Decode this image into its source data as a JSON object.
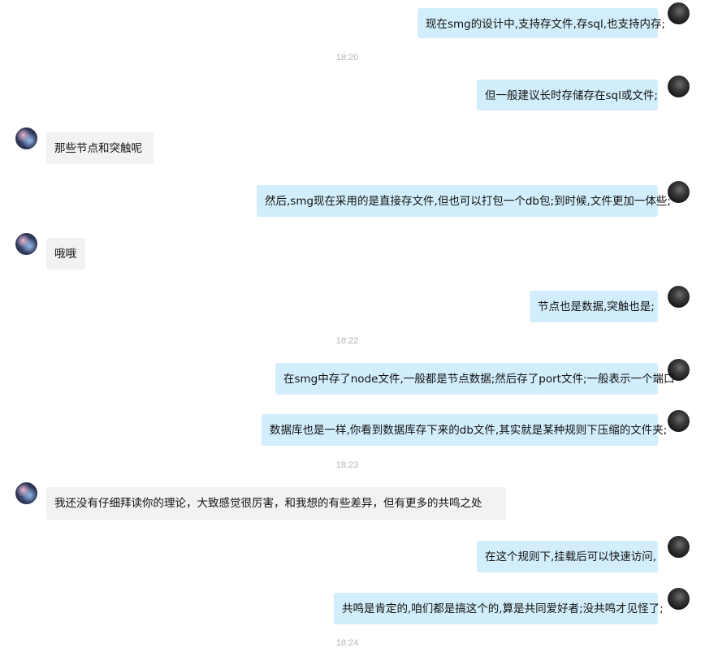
{
  "messages": [
    {
      "sender": "me",
      "text": "现在smg的设计中,支持存文件,存sql,也支持内存;"
    },
    {
      "time": "18:20"
    },
    {
      "sender": "me",
      "text": "但一般建议长时存储存在sql或文件;"
    },
    {
      "sender": "other",
      "text": "那些节点和突触呢"
    },
    {
      "sender": "me",
      "text": "然后,smg现在采用的是直接存文件,但也可以打包一个db包;到时候,文件更加一体些;"
    },
    {
      "sender": "other",
      "text": "哦哦"
    },
    {
      "sender": "me",
      "text": "节点也是数据,突触也是;"
    },
    {
      "time": "18:22"
    },
    {
      "sender": "me",
      "text": "在smg中存了node文件,一般都是节点数据;然后存了port文件;一般表示一个端口"
    },
    {
      "sender": "me",
      "text": "数据库也是一样,你看到数据库存下来的db文件,其实就是某种规则下压缩的文件夹;"
    },
    {
      "time": "18:23"
    },
    {
      "sender": "other",
      "text": "我还没有仔细拜读你的理论，大致感觉很厉害，和我想的有些差异，但有更多的共鸣之处"
    },
    {
      "sender": "me",
      "text": "在这个规则下,挂载后可以快速访问,"
    },
    {
      "sender": "me",
      "text": "共鸣是肯定的,咱们都是搞这个的,算是共同爱好者;没共鸣才见怪了;"
    },
    {
      "time": "18:24"
    }
  ]
}
